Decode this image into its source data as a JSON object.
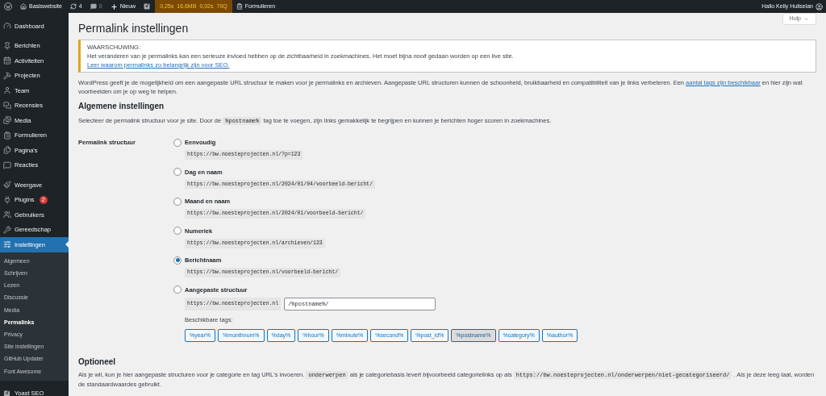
{
  "admin_bar": {
    "items": [
      {
        "kind": "logo"
      },
      {
        "kind": "site",
        "label": "Basiswebsite"
      },
      {
        "kind": "updates",
        "label": "4"
      },
      {
        "kind": "comments",
        "label": "0"
      },
      {
        "kind": "new",
        "label": "Nieuw"
      },
      {
        "kind": "yoast"
      },
      {
        "kind": "metrics",
        "values": [
          "0,25s",
          "16,6MB",
          "0,02s",
          "70Q"
        ]
      },
      {
        "kind": "forms",
        "label": "Formulieren"
      }
    ],
    "greeting": "Hallo Kelly Huliselan"
  },
  "sidebar": {
    "groups": [
      [
        {
          "label": "Dashboard",
          "selected": false
        }
      ],
      [
        {
          "label": "Berichten",
          "selected": false
        },
        {
          "label": "Activiteiten",
          "selected": false
        },
        {
          "label": "Projecten",
          "selected": false
        },
        {
          "label": "Team",
          "selected": false
        },
        {
          "label": "Recensies",
          "selected": false
        },
        {
          "label": "Media",
          "selected": false
        },
        {
          "label": "Formulieren",
          "selected": false
        },
        {
          "label": "Pagina's",
          "selected": false
        },
        {
          "label": "Reacties",
          "selected": false
        }
      ],
      [
        {
          "label": "Weergave",
          "selected": false
        },
        {
          "label": "Plugins",
          "selected": false,
          "badge": "2"
        },
        {
          "label": "Gebruikers",
          "selected": false
        },
        {
          "label": "Gereedschap",
          "selected": false
        },
        {
          "label": "Instellingen",
          "selected": true,
          "children": [
            {
              "label": "Algemeen",
              "selected": false
            },
            {
              "label": "Schrijven",
              "selected": false
            },
            {
              "label": "Lezen",
              "selected": false
            },
            {
              "label": "Discussie",
              "selected": false
            },
            {
              "label": "Media",
              "selected": false
            },
            {
              "label": "Permalinks",
              "selected": true
            },
            {
              "label": "Privacy",
              "selected": false
            },
            {
              "label": "Site instellingen",
              "selected": false
            },
            {
              "label": "GitHub Updater",
              "selected": false
            },
            {
              "label": "Font Awesome",
              "selected": false
            }
          ]
        }
      ],
      [
        {
          "label": "Yoast SEO",
          "selected": false
        }
      ]
    ]
  },
  "help_button": "Hulp",
  "title": "Permalink instellingen",
  "warning": {
    "heading": "WAARSCHUWING:",
    "text": "Het veranderen van je permalinks kan een serieuze invloed hebben op de zichtbaarheid in zoekmachines. Het moet bijna *nooit* gedaan worden op een live site.",
    "link": "Leer waarom permalinks zo belangrijk zijn voor SEO."
  },
  "intro": {
    "before": "WordPress geeft je de mogelijkheid om een aangepaste URL structuur te maken voor je permalinks en archieven. Aangepaste URL structuren kunnen de schoonheid, bruikbaarheid en compatibiliteit van je links verbeteren. Een",
    "link": "aantal tags zijn beschikbaar",
    "after": "en hier zijn wat voorbeelden om je op weg te helpen."
  },
  "general": {
    "heading": "Algemene instellingen",
    "description": [
      {
        "kind": "text",
        "text": "Selecteer de permalink structuur voor je site. Door de"
      },
      {
        "kind": "code",
        "text": "%postname%"
      },
      {
        "kind": "text",
        "text": "tag toe te voegen, zijn links gemakkelijk te begrijpen en kunnen je berichten hoger scoren in zoekmachines."
      }
    ]
  },
  "permalink": {
    "label": "Permalink structuur",
    "options": [
      {
        "kind": "preset",
        "label": "Eenvoudig",
        "example": "https://bw.noesteprojecten.nl/?p=123",
        "selected": false
      },
      {
        "kind": "preset",
        "label": "Dag en naam",
        "example": "https://bw.noesteprojecten.nl/2024/01/04/voorbeeld-bericht/",
        "selected": false
      },
      {
        "kind": "preset",
        "label": "Maand en naam",
        "example": "https://bw.noesteprojecten.nl/2024/01/voorbeeld-bericht/",
        "selected": false
      },
      {
        "kind": "preset",
        "label": "Numeriek",
        "example": "https://bw.noesteprojecten.nl/archieven/123",
        "selected": false
      },
      {
        "kind": "preset",
        "label": "Berichtnaam",
        "example": "https://bw.noesteprojecten.nl/voorbeeld-bericht/",
        "selected": true
      },
      {
        "kind": "custom",
        "label": "Aangepaste structuur",
        "prefix": "https://bw.noesteprojecten.nl",
        "value": "/%postname%/",
        "tags_label": "Beschikbare tags:",
        "tags": [
          {
            "label": "%year%",
            "selected": false
          },
          {
            "label": "%monthnum%",
            "selected": false
          },
          {
            "label": "%day%",
            "selected": false
          },
          {
            "label": "%hour%",
            "selected": false
          },
          {
            "label": "%minute%",
            "selected": false
          },
          {
            "label": "%second%",
            "selected": false
          },
          {
            "label": "%post_id%",
            "selected": false
          },
          {
            "label": "%postname%",
            "selected": true
          },
          {
            "label": "%category%",
            "selected": false
          },
          {
            "label": "%author%",
            "selected": false
          }
        ],
        "selected": false
      }
    ]
  },
  "optional": {
    "heading": "Optioneel",
    "description": [
      {
        "kind": "text",
        "text": "Als je wil, kun je hier aangepaste structuren voor je categorie en tag URL's invoeren."
      },
      {
        "kind": "code",
        "text": "onderwerpen"
      },
      {
        "kind": "text",
        "text": "als je categoriebasis levert bijvoorbeeld categorielinks op als"
      },
      {
        "kind": "code",
        "text": "https://bw.noesteprojecten.nl/onderwerpen/niet-gecategoriseerd/"
      },
      {
        "kind": "text",
        "text": ". Als je deze leeg laat, worden de standaardwaardes gebruikt."
      }
    ]
  }
}
